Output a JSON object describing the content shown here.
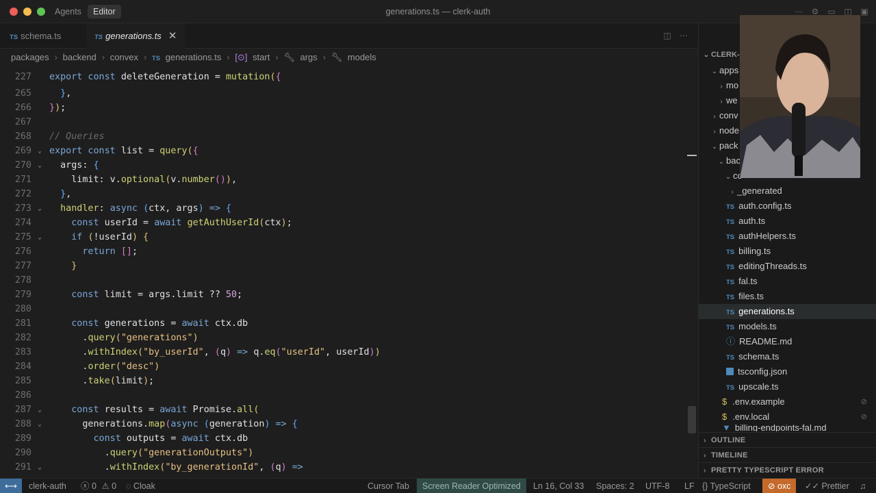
{
  "titlebar": {
    "modes": [
      "Agents",
      "Editor"
    ],
    "active_mode": "Editor",
    "title": "generations.ts — clerk-auth"
  },
  "tabs": [
    {
      "icon": "TS",
      "label": "schema.ts",
      "active": false
    },
    {
      "icon": "TS",
      "label": "generations.ts",
      "active": true
    }
  ],
  "breadcrumb": [
    "packages",
    "backend",
    "convex",
    "generations.ts",
    "start",
    "args",
    "models"
  ],
  "editor": {
    "lines": [
      {
        "n": "227",
        "fold": false
      },
      {
        "n": "265",
        "fold": false
      },
      {
        "n": "266",
        "fold": false
      },
      {
        "n": "267",
        "fold": false
      },
      {
        "n": "268",
        "fold": false
      },
      {
        "n": "269",
        "fold": true
      },
      {
        "n": "270",
        "fold": true
      },
      {
        "n": "271",
        "fold": false
      },
      {
        "n": "272",
        "fold": false
      },
      {
        "n": "273",
        "fold": true
      },
      {
        "n": "274",
        "fold": false
      },
      {
        "n": "275",
        "fold": true
      },
      {
        "n": "276",
        "fold": false
      },
      {
        "n": "277",
        "fold": false
      },
      {
        "n": "278",
        "fold": false
      },
      {
        "n": "279",
        "fold": false
      },
      {
        "n": "280",
        "fold": false
      },
      {
        "n": "281",
        "fold": false
      },
      {
        "n": "282",
        "fold": false
      },
      {
        "n": "283",
        "fold": false
      },
      {
        "n": "284",
        "fold": false
      },
      {
        "n": "285",
        "fold": false
      },
      {
        "n": "286",
        "fold": false
      },
      {
        "n": "287",
        "fold": true
      },
      {
        "n": "288",
        "fold": true
      },
      {
        "n": "289",
        "fold": false
      },
      {
        "n": "290",
        "fold": false
      },
      {
        "n": "291",
        "fold": true
      }
    ]
  },
  "explorer": {
    "root": "CLERK-",
    "items": [
      {
        "label": "apps",
        "type": "folder-open",
        "depth": 1
      },
      {
        "label": "mo",
        "type": "folder",
        "depth": 2
      },
      {
        "label": "we",
        "type": "folder",
        "depth": 2
      },
      {
        "label": "conv",
        "type": "folder",
        "depth": 1
      },
      {
        "label": "node",
        "type": "folder",
        "depth": 1
      },
      {
        "label": "pack",
        "type": "folder-open",
        "depth": 1
      },
      {
        "label": "bac",
        "type": "folder-open",
        "depth": 2
      },
      {
        "label": "co",
        "type": "folder-open",
        "depth": 3
      },
      {
        "label": "_generated",
        "type": "folder",
        "depth": 4
      },
      {
        "label": "auth.config.ts",
        "type": "ts",
        "depth": 4
      },
      {
        "label": "auth.ts",
        "type": "ts",
        "depth": 4
      },
      {
        "label": "authHelpers.ts",
        "type": "ts",
        "depth": 4
      },
      {
        "label": "billing.ts",
        "type": "ts",
        "depth": 4
      },
      {
        "label": "editingThreads.ts",
        "type": "ts",
        "depth": 4
      },
      {
        "label": "fal.ts",
        "type": "ts",
        "depth": 4
      },
      {
        "label": "files.ts",
        "type": "ts",
        "depth": 4
      },
      {
        "label": "generations.ts",
        "type": "ts",
        "depth": 4,
        "selected": true
      },
      {
        "label": "models.ts",
        "type": "ts",
        "depth": 4
      },
      {
        "label": "README.md",
        "type": "info",
        "depth": 4
      },
      {
        "label": "schema.ts",
        "type": "ts",
        "depth": 4
      },
      {
        "label": "tsconfig.json",
        "type": "json",
        "depth": 4
      },
      {
        "label": "upscale.ts",
        "type": "ts",
        "depth": 4
      },
      {
        "label": ".env.example",
        "type": "env",
        "depth": 3
      },
      {
        "label": ".env.local",
        "type": "env",
        "depth": 3
      },
      {
        "label": "billing-endpoints-fal.md",
        "type": "md",
        "depth": 3
      }
    ],
    "sections": [
      "OUTLINE",
      "TIMELINE",
      "PRETTY TYPESCRIPT ERROR"
    ]
  },
  "statusbar": {
    "branch": "clerk-auth",
    "errors": "0",
    "warnings": "0",
    "cloak": "Cloak",
    "cursor_tab": "Cursor Tab",
    "screen_reader": "Screen Reader Optimized",
    "position": "Ln 16, Col 33",
    "spaces": "Spaces: 2",
    "encoding": "UTF-8",
    "eol": "LF",
    "language": "TypeScript",
    "linter": "oxc",
    "formatter": "Prettier",
    "accent": "#3e6d9c"
  }
}
